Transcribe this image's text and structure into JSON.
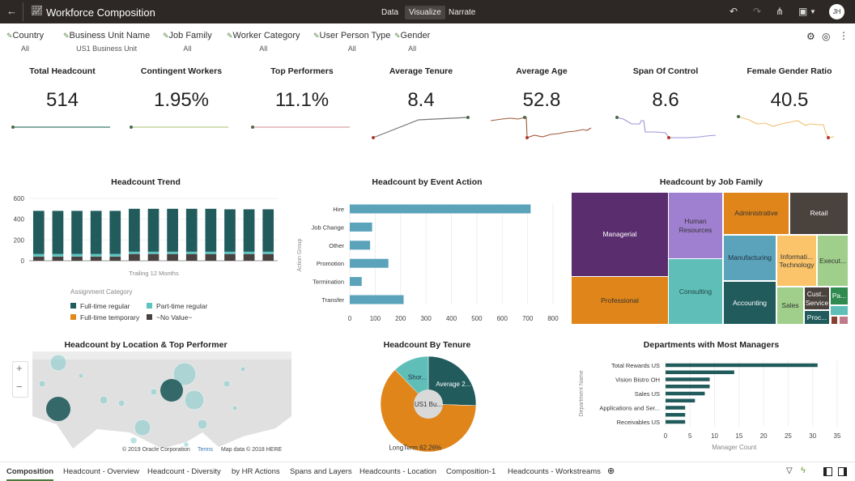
{
  "header": {
    "title": "Workforce Composition",
    "nav": [
      "Data",
      "Visualize",
      "Narrate"
    ],
    "active_nav": "Visualize",
    "avatar": "JH",
    "icons": [
      "back-arrow-icon",
      "chart-icon",
      "undo-icon",
      "redo-icon",
      "share-icon",
      "save-icon",
      "chevron-down-icon"
    ]
  },
  "filters": [
    {
      "label": "Country",
      "value": "All"
    },
    {
      "label": "Business Unit Name",
      "value": "US1 Business Unit"
    },
    {
      "label": "Job Family",
      "value": "All"
    },
    {
      "label": "Worker Category",
      "value": "All"
    },
    {
      "label": "User Person Type",
      "value": "All"
    },
    {
      "label": "Gender",
      "value": "All"
    }
  ],
  "kpis": [
    {
      "label": "Total Headcount",
      "value": "514",
      "color": "#3f7a6a"
    },
    {
      "label": "Contingent Workers",
      "value": "1.95%",
      "color": "#b9c98a"
    },
    {
      "label": "Top Performers",
      "value": "11.1%",
      "color": "#d9a0a8"
    },
    {
      "label": "Average Tenure",
      "value": "8.4",
      "color": "#777777"
    },
    {
      "label": "Average Age",
      "value": "52.8",
      "color": "#a0583a"
    },
    {
      "label": "Span Of Control",
      "value": "8.6",
      "color": "#9a96d8"
    },
    {
      "label": "Female Gender Ratio",
      "value": "40.5",
      "color": "#f0c070"
    }
  ],
  "chart_data": [
    {
      "type": "bar",
      "stacked": true,
      "title": "Headcount Trend",
      "xlabel": "Trailing 12 Months",
      "ylim": [
        0,
        600
      ],
      "yticks": [
        "0",
        "200",
        "400",
        "600"
      ],
      "legend_title": "Assignment Category",
      "legend_placement": "bottom",
      "series": [
        {
          "name": "~No Value~",
          "color": "#4a4240",
          "values": [
            40,
            40,
            40,
            40,
            40,
            65,
            65,
            65,
            65,
            65,
            65,
            65,
            65
          ]
        },
        {
          "name": "Part-time regular",
          "color": "#5ec4c0",
          "values": [
            25,
            25,
            25,
            25,
            25,
            22,
            22,
            22,
            22,
            22,
            22,
            22,
            22
          ]
        },
        {
          "name": "Full-time temporary",
          "color": "#e08a1e",
          "values": [
            0,
            0,
            0,
            0,
            0,
            0,
            0,
            0,
            0,
            0,
            0,
            0,
            0
          ]
        },
        {
          "name": "Full-time regular",
          "color": "#215b5c",
          "values": [
            415,
            415,
            415,
            415,
            415,
            413,
            413,
            413,
            413,
            413,
            408,
            408,
            408
          ]
        }
      ]
    },
    {
      "type": "bar",
      "orientation": "horizontal",
      "title": "Headcount by Event Action",
      "ylabel": "Action Group",
      "xlim": [
        0,
        800
      ],
      "xticks": [
        "0",
        "100",
        "200",
        "300",
        "400",
        "500",
        "600",
        "700",
        "800"
      ],
      "categories": [
        "Hire",
        "Job Change",
        "Other",
        "Promotion",
        "Termination",
        "Transfer"
      ],
      "values": [
        712,
        88,
        80,
        152,
        47,
        212
      ],
      "color": "#5aa3bb"
    },
    {
      "type": "treemap",
      "title": "Headcount by Job Family",
      "items": [
        {
          "label": "Managerial",
          "color": "#5a2d6e",
          "text": "#fff"
        },
        {
          "label": "Professional",
          "color": "#e0851a",
          "text": "#333"
        },
        {
          "label": "Human Resources",
          "color": "#9f7fcf",
          "text": "#333"
        },
        {
          "label": "Consulting",
          "color": "#5fbfb8",
          "text": "#244"
        },
        {
          "label": "Administrative",
          "color": "#e0851a",
          "text": "#333"
        },
        {
          "label": "Retail",
          "color": "#4a423d",
          "text": "#fff"
        },
        {
          "label": "Manufacturing",
          "color": "#5aa3bb",
          "text": "#234"
        },
        {
          "label": "Accounting",
          "color": "#215b5c",
          "text": "#fff"
        },
        {
          "label": "Informati... Technology",
          "color": "#fbc46a",
          "text": "#333"
        },
        {
          "label": "Execut...",
          "color": "#9fcf8a",
          "text": "#333"
        },
        {
          "label": "Sales",
          "color": "#9fcf8a",
          "text": "#333"
        },
        {
          "label": "Cust... Service",
          "color": "#4a423d",
          "text": "#fff"
        },
        {
          "label": "Pa...",
          "color": "#2f8a50",
          "text": "#fff"
        },
        {
          "label": "",
          "color": "#5fbfb8",
          "text": "#333"
        },
        {
          "label": "Proc...",
          "color": "#215b5c",
          "text": "#fff"
        },
        {
          "label": "",
          "color": "#8a4030",
          "text": "#fff"
        },
        {
          "label": "",
          "color": "#c07a8a",
          "text": "#fff"
        }
      ]
    },
    {
      "type": "map",
      "title": "Headcount by Location & Top Performer",
      "attribution": "© 2019 Oracle Corporation",
      "terms": "Terms",
      "mapdata": "Map data © 2018 HERE",
      "zoom_in": "+",
      "zoom_out": "−"
    },
    {
      "type": "pie",
      "title": "Headcount By Tenure",
      "center_label": "US1 Bu...",
      "slices": [
        {
          "label": "Average 2...",
          "value": 25.5,
          "color": "#215b5c"
        },
        {
          "label": "LongTerm 62.26%",
          "value": 62.26,
          "color": "#e0851a"
        },
        {
          "label": "Shor...",
          "value": 12.24,
          "color": "#5fbfb8"
        }
      ]
    },
    {
      "type": "bar",
      "orientation": "horizontal",
      "title": "Departments with Most Managers",
      "xlabel": "Manager Count",
      "ylabel": "Department Name",
      "xlim": [
        0,
        35
      ],
      "xticks": [
        "0",
        "5",
        "10",
        "15",
        "20",
        "25",
        "30",
        "35"
      ],
      "categories": [
        "Total Rewards US",
        "",
        "Vision Bistro OH",
        "",
        "Sales US",
        "",
        "Applications and Ser...",
        "",
        "Receivables US"
      ],
      "values": [
        31,
        14,
        9,
        9,
        8,
        6,
        4,
        4,
        4
      ],
      "color": "#215b5c"
    }
  ],
  "tabs": [
    "Composition",
    "Headcount - Overview",
    "Headcount - Diversity",
    "by HR Actions",
    "Spans and Layers",
    "Headcounts - Location",
    "Composition-1",
    "Headcounts - Workstreams"
  ],
  "active_tab": "Composition",
  "add_tab": "⊕"
}
